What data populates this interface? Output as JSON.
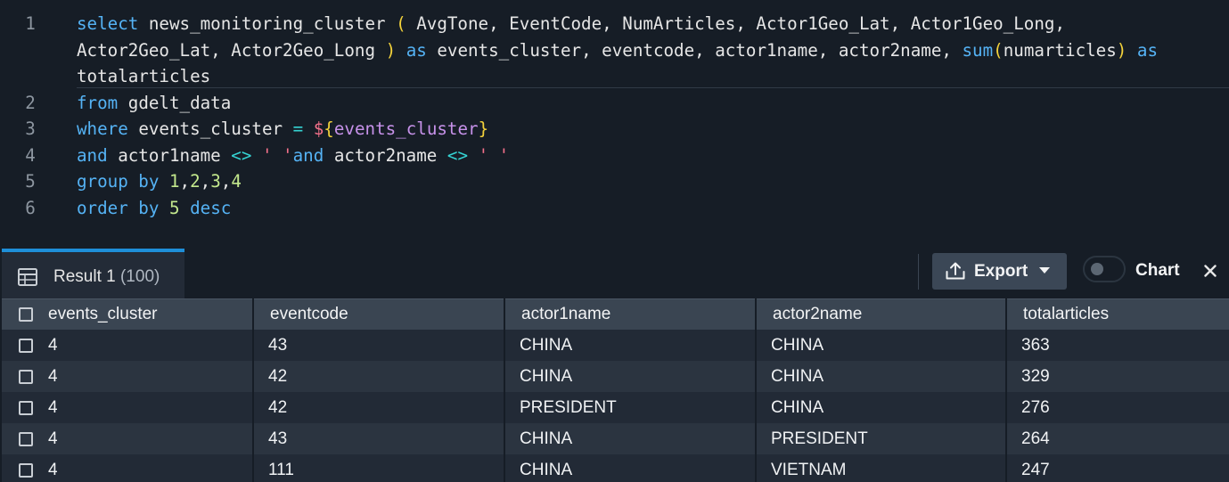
{
  "editor": {
    "line_numbers": [
      "1",
      "2",
      "3",
      "4",
      "5",
      "6"
    ],
    "line1a": {
      "select": "select",
      "t1": " news_monitoring_cluster ",
      "p1": "(",
      "t2": " AvgTone, EventCode, NumArticles, Actor1Geo_Lat, Actor1Geo_Long,"
    },
    "line1b": {
      "t1": "Actor2Geo_Lat, Actor2Geo_Long ",
      "p1": ")",
      "sp": " ",
      "as": "as",
      "t2": " events_cluster, eventcode, actor1name, actor2name, ",
      "sum": "sum",
      "p2": "(",
      "arg": "numarticles",
      "p3": ")",
      "sp2": " ",
      "as2": "as"
    },
    "line1c": {
      "t1": "totalarticles"
    },
    "line2": {
      "kw": "from",
      "t1": " gdelt_data"
    },
    "line3": {
      "kw": "where",
      "t1": " events_cluster ",
      "op": "=",
      "sp": " ",
      "dollar": "$",
      "b1": "{",
      "var": "events_cluster",
      "b2": "}"
    },
    "line4": {
      "kw1": "and",
      "t1": " actor1name ",
      "op1": "<>",
      "sp1": " ",
      "s1": "' '",
      "kw2": "and",
      "t2": " actor2name ",
      "op2": "<>",
      "sp2": " ",
      "s2": "' '"
    },
    "line5": {
      "kw": "group by",
      "sp": " ",
      "n1": "1",
      "c1": ",",
      "n2": "2",
      "c2": ",",
      "n3": "3",
      "c3": ",",
      "n4": "4"
    },
    "line6": {
      "kw": "order by",
      "sp": " ",
      "n": "5",
      "sp2": " ",
      "kw2": "desc"
    }
  },
  "results": {
    "tab_label": "Result 1",
    "tab_count": "(100)",
    "export_label": "Export",
    "chart_label": "Chart",
    "columns": [
      "events_cluster",
      "eventcode",
      "actor1name",
      "actor2name",
      "totalarticles"
    ],
    "rows": [
      [
        "4",
        "43",
        "CHINA",
        "CHINA",
        "363"
      ],
      [
        "4",
        "42",
        "CHINA",
        "CHINA",
        "329"
      ],
      [
        "4",
        "42",
        "PRESIDENT",
        "CHINA",
        "276"
      ],
      [
        "4",
        "43",
        "CHINA",
        "PRESIDENT",
        "264"
      ],
      [
        "4",
        "111",
        "CHINA",
        "VIETNAM",
        "247"
      ]
    ]
  },
  "colors": {
    "keyword": "#55b3f5",
    "paren": "#f3d23b",
    "variable": "#c792ea",
    "operator": "#35d3d3",
    "string": "#f5718b",
    "number": "#c3e88d",
    "tab_accent": "#1e8fd8"
  },
  "icons": {
    "tab": "table-icon",
    "export": "upload-icon",
    "caret": "caret-down-icon",
    "close": "close-icon",
    "checkbox": "checkbox-icon"
  }
}
